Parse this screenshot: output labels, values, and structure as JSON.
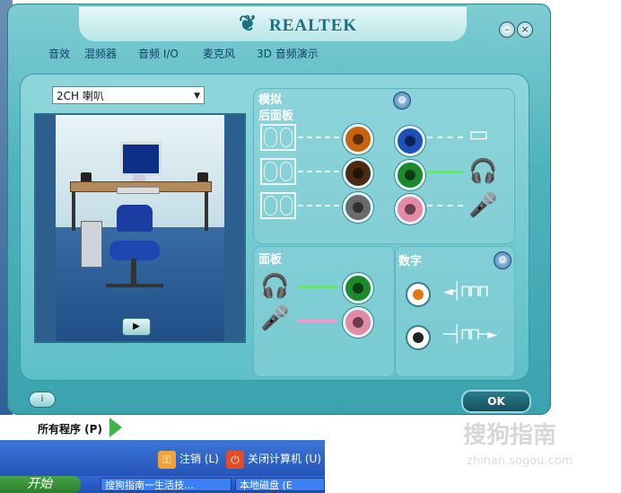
{
  "window": {
    "brand": "REALTEK",
    "brand_mark": "❦",
    "minimize_symbol": "–",
    "close_symbol": "×"
  },
  "tabs": [
    {
      "label": "音效"
    },
    {
      "label": "混频器"
    },
    {
      "label": "音频 I/O"
    },
    {
      "label": "麦克风"
    },
    {
      "label": "3D 音频演示"
    }
  ],
  "speaker_config": {
    "selected": "2CH 喇叭"
  },
  "analog": {
    "title": "模拟",
    "rear_panel_title": "后面板"
  },
  "front": {
    "title": "面板"
  },
  "digital": {
    "title": "数字"
  },
  "rear_jacks": [
    {
      "color": "#c8640f"
    },
    {
      "color": "#4a2a10"
    },
    {
      "color": "#6a6a6a"
    },
    {
      "color": "#1f4fb8"
    },
    {
      "color": "#1c8a2c"
    },
    {
      "color": "#e58aa6"
    }
  ],
  "front_jacks": [
    {
      "color": "#1c8a2c"
    },
    {
      "color": "#e58aa6"
    }
  ],
  "ok_label": "OK",
  "info_label": "i",
  "play_symbol": "▶",
  "start_menu": {
    "all_programs": "所有程序 (P)",
    "logoff": "注销 (L)",
    "shutdown": "关闭计算机 (U)"
  },
  "taskbar": {
    "start": "开始",
    "tasks": [
      "搜狗指南一生活技…",
      "本地磁盘 (E"
    ]
  },
  "watermark": {
    "text": "搜狗指南",
    "url": "zhinan.sogou.com"
  }
}
